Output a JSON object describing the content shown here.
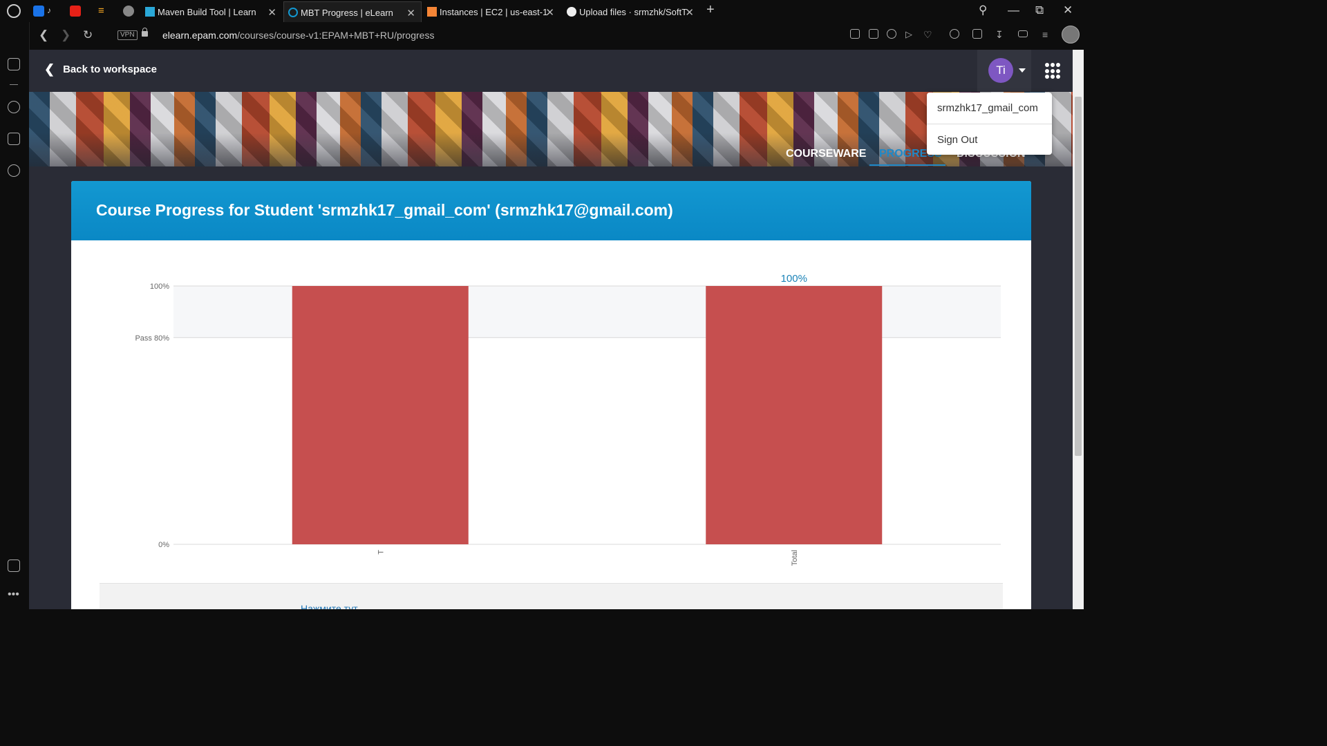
{
  "browser": {
    "tabs": [
      {
        "label": "Maven Build Tool | Learn",
        "active": false
      },
      {
        "label": "MBT Progress | eLearn",
        "active": true
      },
      {
        "label": "Instances | EC2 | us-east-1",
        "active": false
      },
      {
        "label": "Upload files · srmzhk/SoftT",
        "active": false
      }
    ],
    "url_domain": "elearn.epam.com",
    "url_path": "/courses/course-v1:EPAM+MBT+RU/progress",
    "vpn_label": "VPN"
  },
  "page": {
    "back_label": "Back to workspace",
    "avatar_initials": "Ti",
    "course_tabs": [
      "COURSEWARE",
      "PROGRESS",
      "DISCUSSION"
    ],
    "dropdown": {
      "username": "srmzhk17_gmail_com",
      "sign_out": "Sign Out"
    },
    "card_title": "Course Progress for Student 'srmzhk17_gmail_com' (srmzhk17@gmail.com)",
    "bottom_link": "Нажмите тут"
  },
  "colors": {
    "accent": "#1398d1",
    "bar": "#c64f4f",
    "avatar": "#7e57c2"
  },
  "chart_data": {
    "type": "bar",
    "categories": [
      "T",
      "Total"
    ],
    "values": [
      100,
      100
    ],
    "data_labels": [
      "",
      "100%"
    ],
    "y_ticks": [
      {
        "value": 0,
        "label": "0%"
      },
      {
        "value": 80,
        "label": "Pass 80%"
      },
      {
        "value": 100,
        "label": "100%"
      }
    ],
    "ylim": [
      0,
      100
    ],
    "pass_threshold": 80,
    "grid": true
  }
}
